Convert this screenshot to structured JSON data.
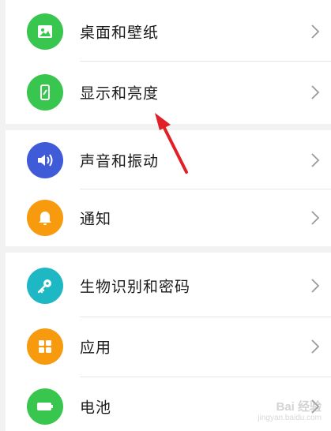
{
  "settings": {
    "items": [
      {
        "label": "桌面和壁纸",
        "icon": "image-icon",
        "color": "#39c64e"
      },
      {
        "label": "显示和亮度",
        "icon": "phone-brightness-icon",
        "color": "#39c64e"
      },
      {
        "label": "声音和振动",
        "icon": "speaker-icon",
        "color": "#3f5bd8"
      },
      {
        "label": "通知",
        "icon": "bell-icon",
        "color": "#f79a0e"
      },
      {
        "label": "生物识别和密码",
        "icon": "key-icon",
        "color": "#1eb8c4"
      },
      {
        "label": "应用",
        "icon": "apps-grid-icon",
        "color": "#f79a0e"
      },
      {
        "label": "电池",
        "icon": "battery-icon",
        "color": "#39c64e"
      }
    ]
  },
  "watermark": {
    "text": "Bai 经验",
    "sub": "jingyan.baidu.com"
  },
  "annotation": {
    "color": "#e02027"
  }
}
